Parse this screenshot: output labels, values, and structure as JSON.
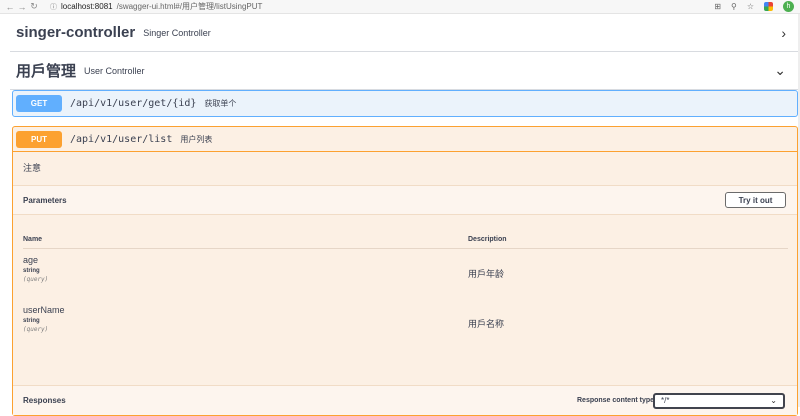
{
  "browser": {
    "url_host": "localhost:8081",
    "url_path": "/swagger-ui.html#/用户管理/listUsingPUT",
    "avatar_letter": "h"
  },
  "tags": [
    {
      "name": "singer-controller",
      "description": "Singer Controller",
      "expanded": false
    },
    {
      "name": "用戶管理",
      "description": "User Controller",
      "expanded": true
    }
  ],
  "operations": {
    "get": {
      "method": "GET",
      "path": "/api/v1/user/get/{id}",
      "summary": "获取单个"
    },
    "put": {
      "method": "PUT",
      "path": "/api/v1/user/list",
      "summary": "用户列表",
      "description": "注意",
      "parameters_title": "Parameters",
      "try_it_out": "Try it out",
      "columns": {
        "name": "Name",
        "description": "Description"
      },
      "params": [
        {
          "name": "age",
          "type": "string",
          "in": "(query)",
          "description": "用戶年龄"
        },
        {
          "name": "userName",
          "type": "string",
          "in": "(query)",
          "description": "用戶名称"
        }
      ],
      "responses_title": "Responses",
      "response_content_type_label": "Response content type",
      "response_content_type_value": "*/*"
    }
  },
  "colors": {
    "get": "#61affe",
    "put": "#fca130"
  }
}
